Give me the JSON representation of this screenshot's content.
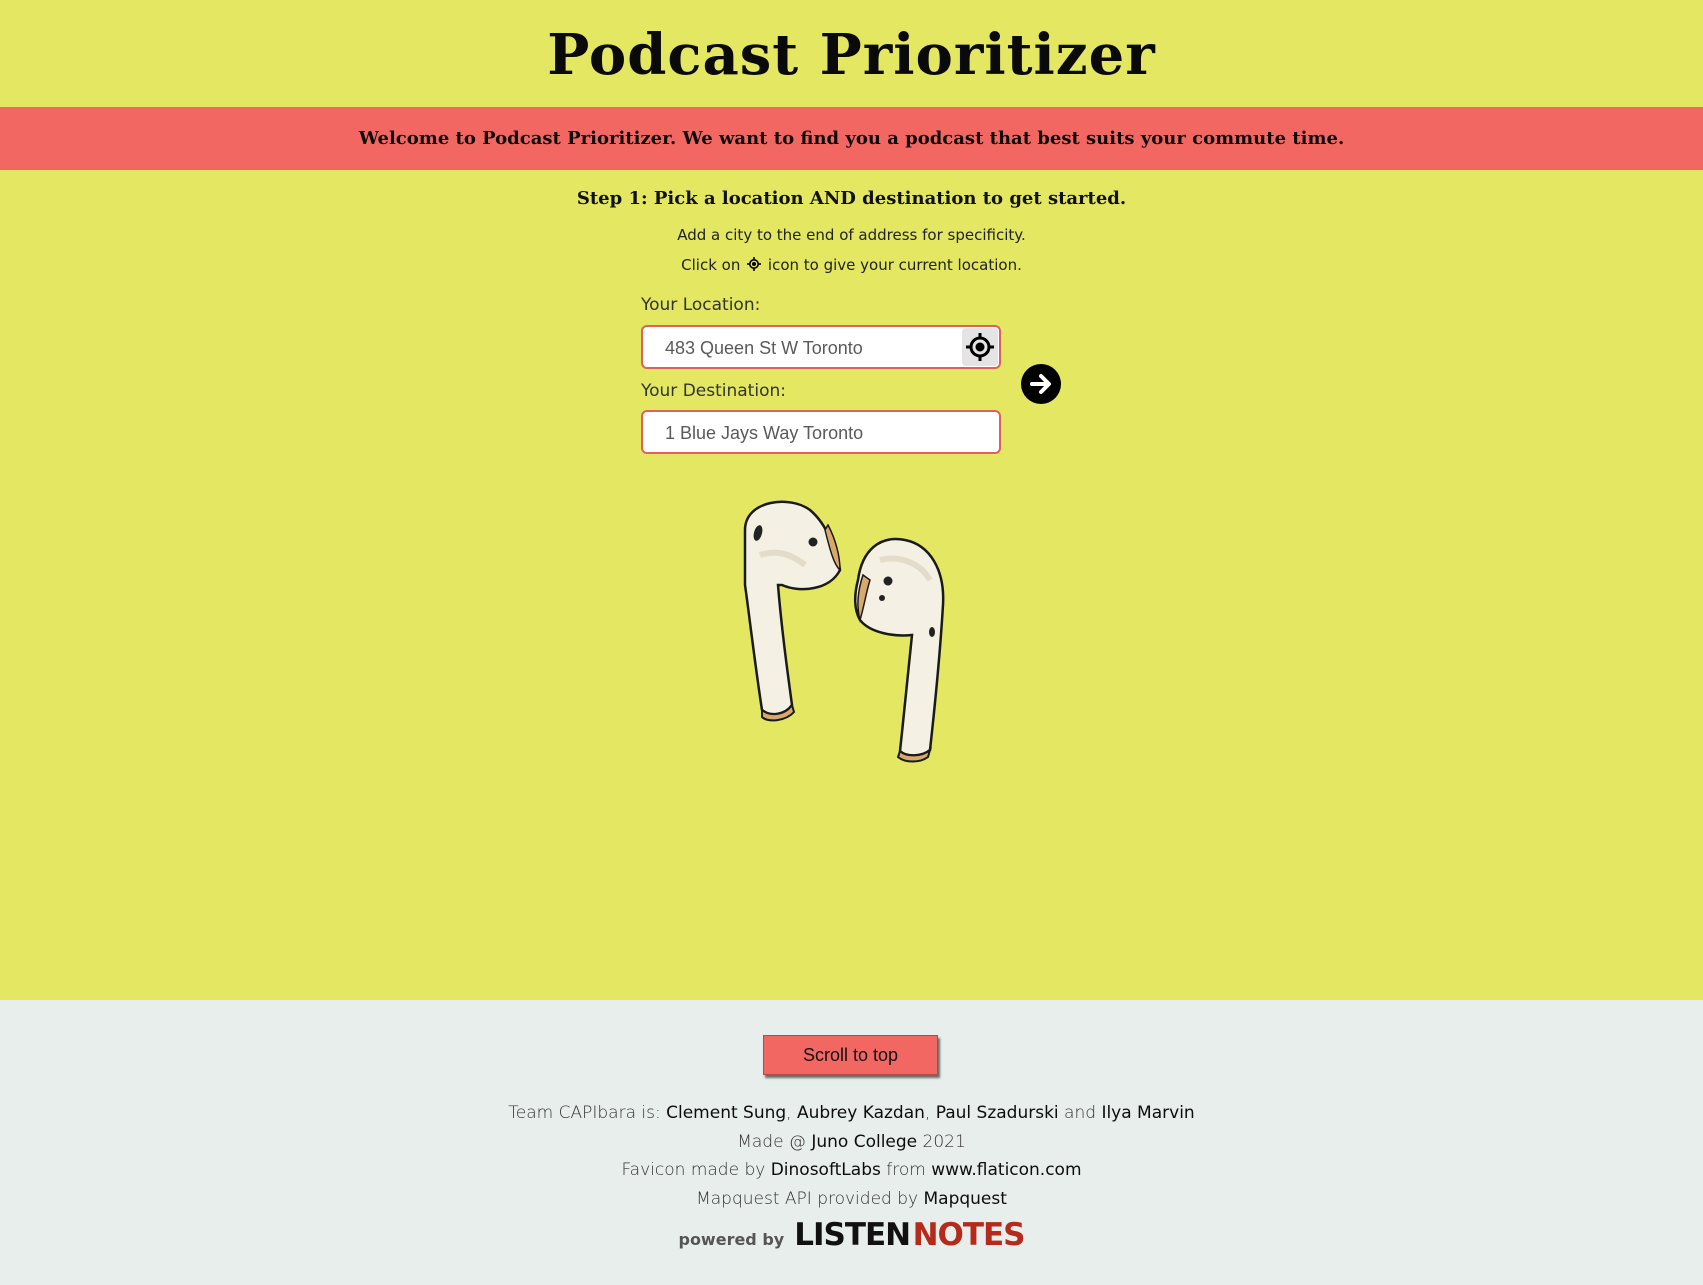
{
  "header": {
    "title": "Podcast Prioritizer"
  },
  "banner": {
    "text": "Welcome to Podcast Prioritizer. We want to find you a podcast that best suits your commute time."
  },
  "step": {
    "heading": "Step 1: Pick a location AND destination to get started.",
    "hint1": "Add a city to the end of address for specificity.",
    "hint2_before": "Click on",
    "hint2_after": "icon to give your current location."
  },
  "form": {
    "location_label": "Your Location:",
    "location_placeholder": "483 Queen St W Toronto",
    "destination_label": "Your Destination:",
    "destination_placeholder": "1 Blue Jays Way Toronto",
    "locate_icon": "crosshair-icon",
    "submit_icon": "arrow-right-circle-icon"
  },
  "illustration": {
    "name": "earbuds-illustration"
  },
  "footer": {
    "scroll_label": "Scroll to top",
    "team_prefix": "Team CAPIbara is:",
    "members": [
      "Clement Sung",
      "Aubrey Kazdan",
      "Paul Szadurski",
      "Ilya Marvin"
    ],
    "sep_comma": ",",
    "sep_and": "and",
    "made_prefix": "Made @",
    "made_org": "Juno College",
    "made_year": "2021",
    "favicon_prefix": "Favicon made by",
    "favicon_author": "DinosoftLabs",
    "favicon_from": "from",
    "favicon_site": "www.flaticon.com",
    "mapquest_prefix": "Mapquest API provided by",
    "mapquest_name": "Mapquest",
    "powered_by": "powered by",
    "listen": "LISTEN",
    "notes": "NOTES"
  },
  "colors": {
    "background": "#e3e762",
    "accent": "#f36763",
    "footer": "#e7eeeb"
  }
}
